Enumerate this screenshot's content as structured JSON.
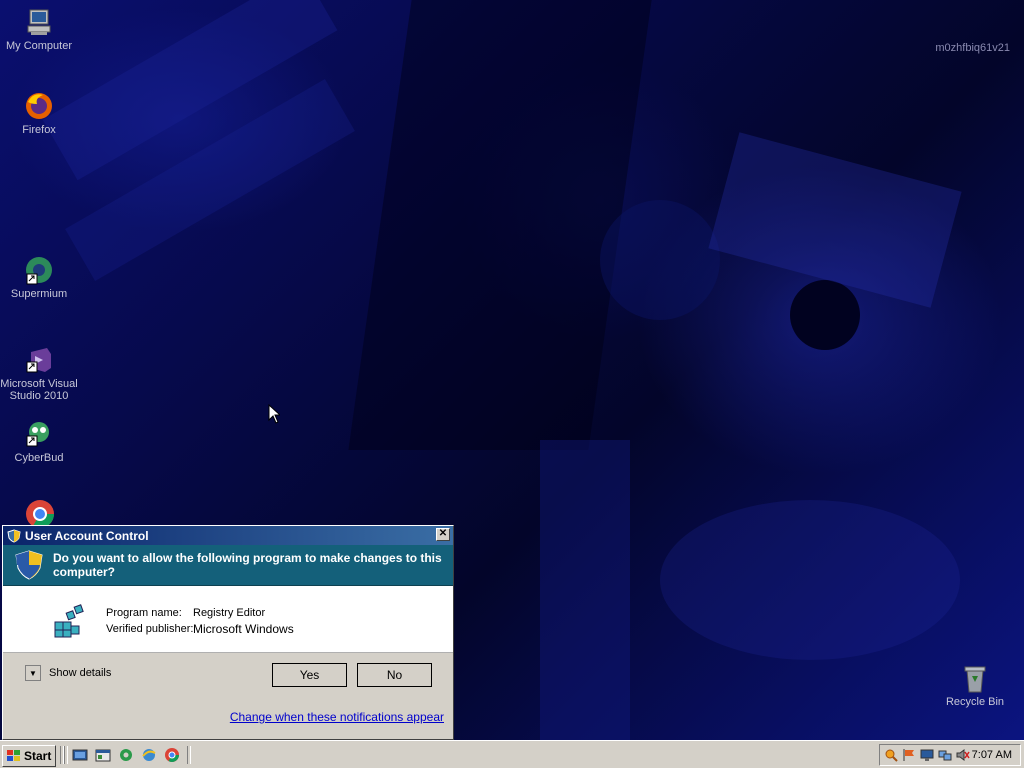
{
  "desktop": {
    "hostname": "m0zhfbiq61v21",
    "icons": [
      {
        "label": "My Computer",
        "icon": "computer-icon"
      },
      {
        "label": "Firefox",
        "icon": "firefox-icon"
      },
      {
        "label": "Supermium",
        "icon": "supermium-icon"
      },
      {
        "label": "Microsoft Visual Studio 2010",
        "icon": "visual-studio-icon"
      },
      {
        "label": "CyberBud",
        "icon": "cyberbud-icon"
      },
      {
        "label": "Recycle Bin",
        "icon": "recycle-bin-icon"
      }
    ]
  },
  "uac": {
    "title": "User Account Control",
    "question": "Do you want to allow the following program to make changes to this computer?",
    "program_label": "Program name:",
    "program_value": "Registry Editor",
    "publisher_label": "Verified publisher:",
    "publisher_value": "Microsoft Windows",
    "show_details": "Show details",
    "yes": "Yes",
    "no": "No",
    "link": "Change when these notifications appear",
    "close": "✕"
  },
  "taskbar": {
    "start": "Start",
    "clock": "7:07 AM",
    "quick_launch": [
      "desktop-icon",
      "explorer-icon",
      "cyberbud-icon",
      "ie-icon",
      "chrome-icon"
    ],
    "tray_icons": [
      "magnifier-icon",
      "flag-icon",
      "monitor-icon",
      "network-icon",
      "volume-muted-icon"
    ]
  },
  "colors": {
    "banner": "#14607a",
    "title_bar_start": "#0a246a",
    "title_bar_end": "#3a6ea5",
    "link": "#0000cc"
  }
}
